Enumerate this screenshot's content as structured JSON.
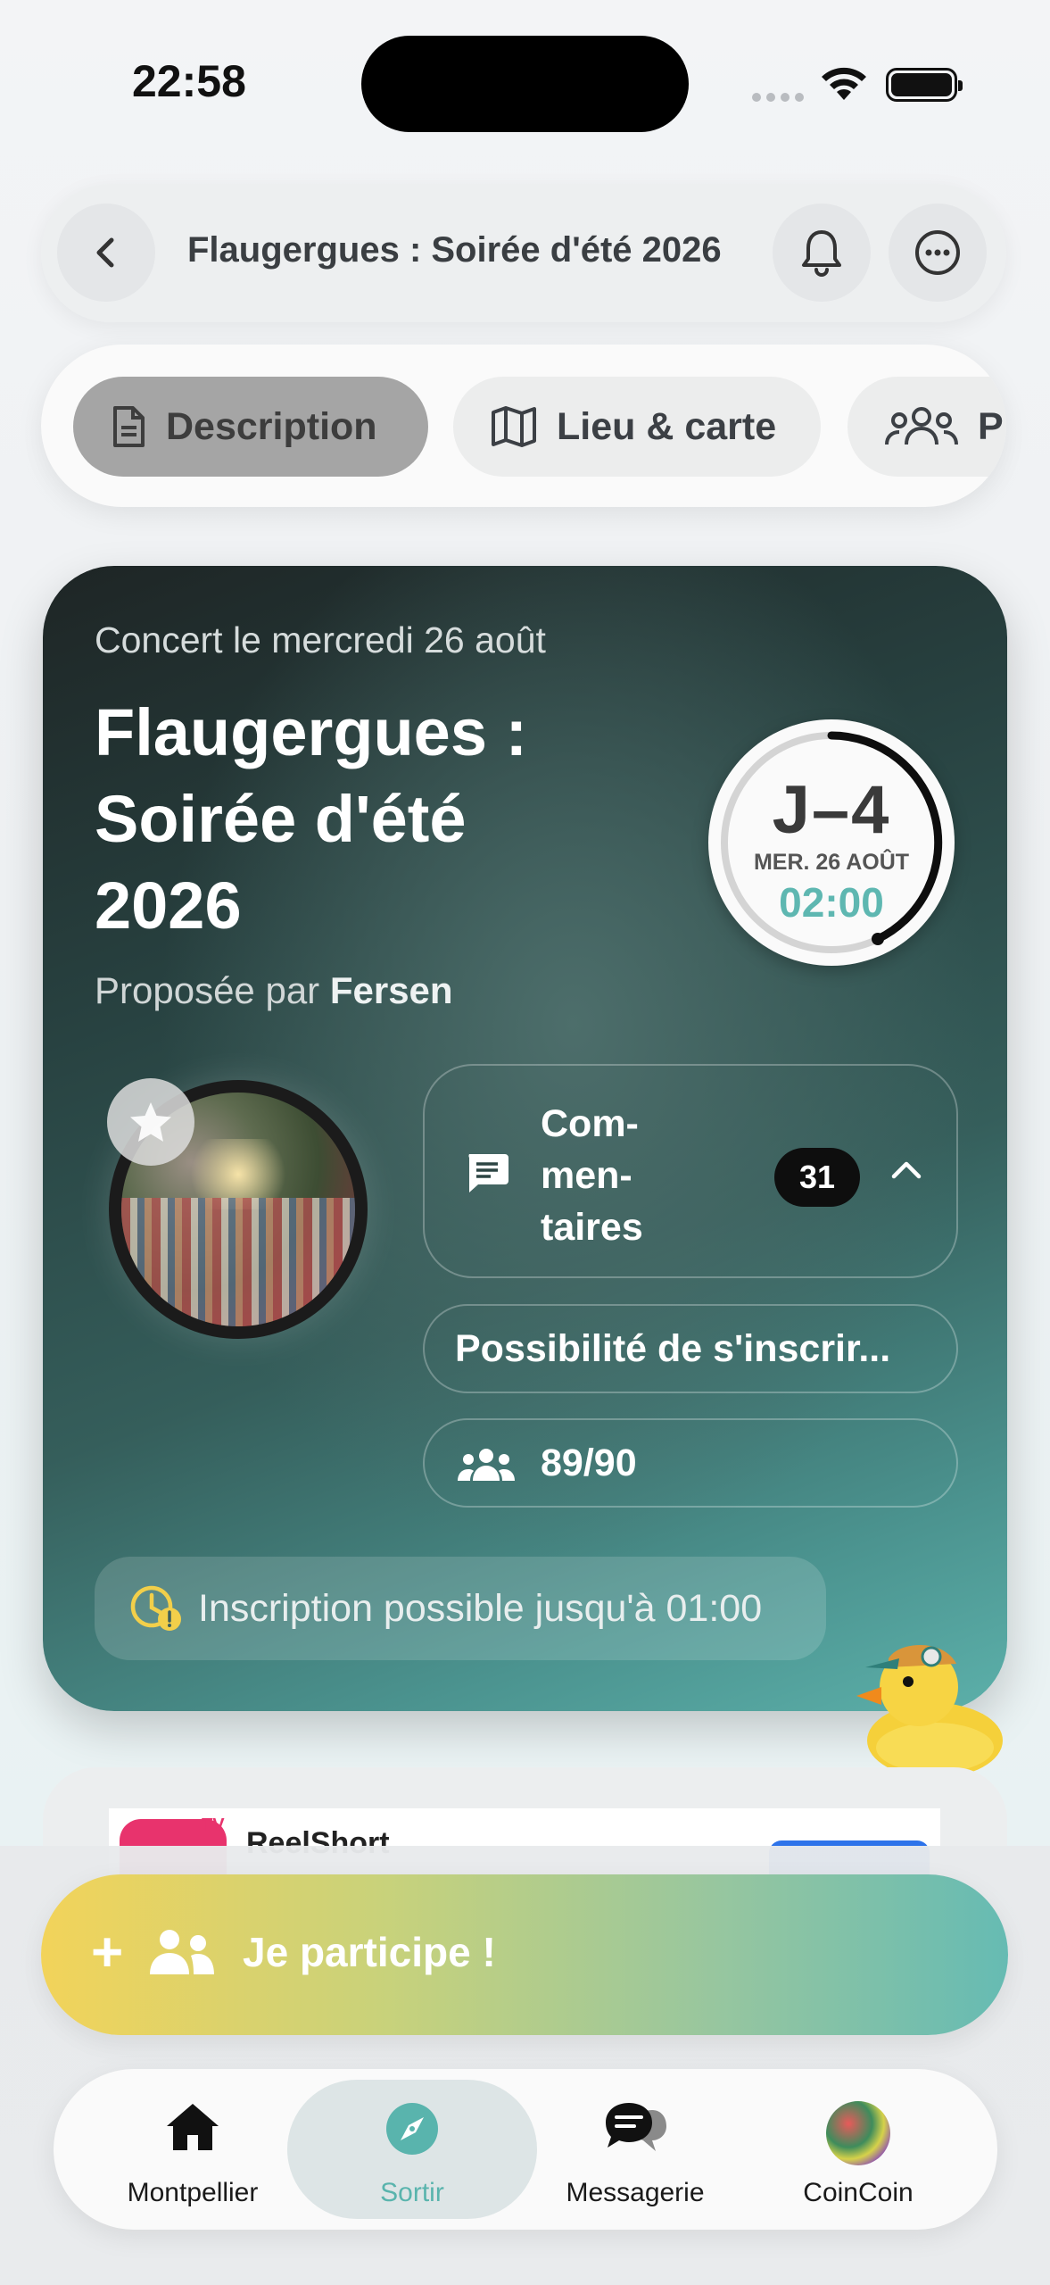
{
  "status_bar": {
    "time": "22:58"
  },
  "header": {
    "title": "Flaugergues : Soirée d'été 2026"
  },
  "tabs": [
    {
      "label": "Description",
      "icon": "document-icon",
      "active": true
    },
    {
      "label": "Lieu & carte",
      "icon": "map-icon",
      "active": false
    },
    {
      "label": "P",
      "icon": "people-icon",
      "active": false
    }
  ],
  "event": {
    "subtitle": "Concert le mercredi 26 août",
    "title": "Flaugergues : Soirée d'été 2026",
    "proposed_by_prefix": "Proposée par ",
    "proposed_by_name": "Fersen",
    "countdown": {
      "days_label": "J–4",
      "date": "MER. 26 AOÛT",
      "time": "02:00"
    },
    "comments": {
      "label": "Com-\nmen-\ntaires",
      "count": "31"
    },
    "signup_label": "Possibilité de s'inscrir...",
    "participants": "89/90",
    "deadline": "Inscription possible jusqu'à 01:00"
  },
  "ad": {
    "name": "ReelShort",
    "badge": "TV"
  },
  "cta": {
    "label": "Je participe !"
  },
  "nav": [
    {
      "label": "Montpellier",
      "icon": "home-icon"
    },
    {
      "label": "Sortir",
      "icon": "compass-icon",
      "active": true
    },
    {
      "label": "Messagerie",
      "icon": "chat-icon"
    },
    {
      "label": "CoinCoin",
      "icon": "avatar-icon"
    }
  ],
  "colors": {
    "accent": "#5eb7b1",
    "card_dark": "#1e2525",
    "cta_start": "#f2d35a",
    "cta_end": "#66bbb3"
  }
}
